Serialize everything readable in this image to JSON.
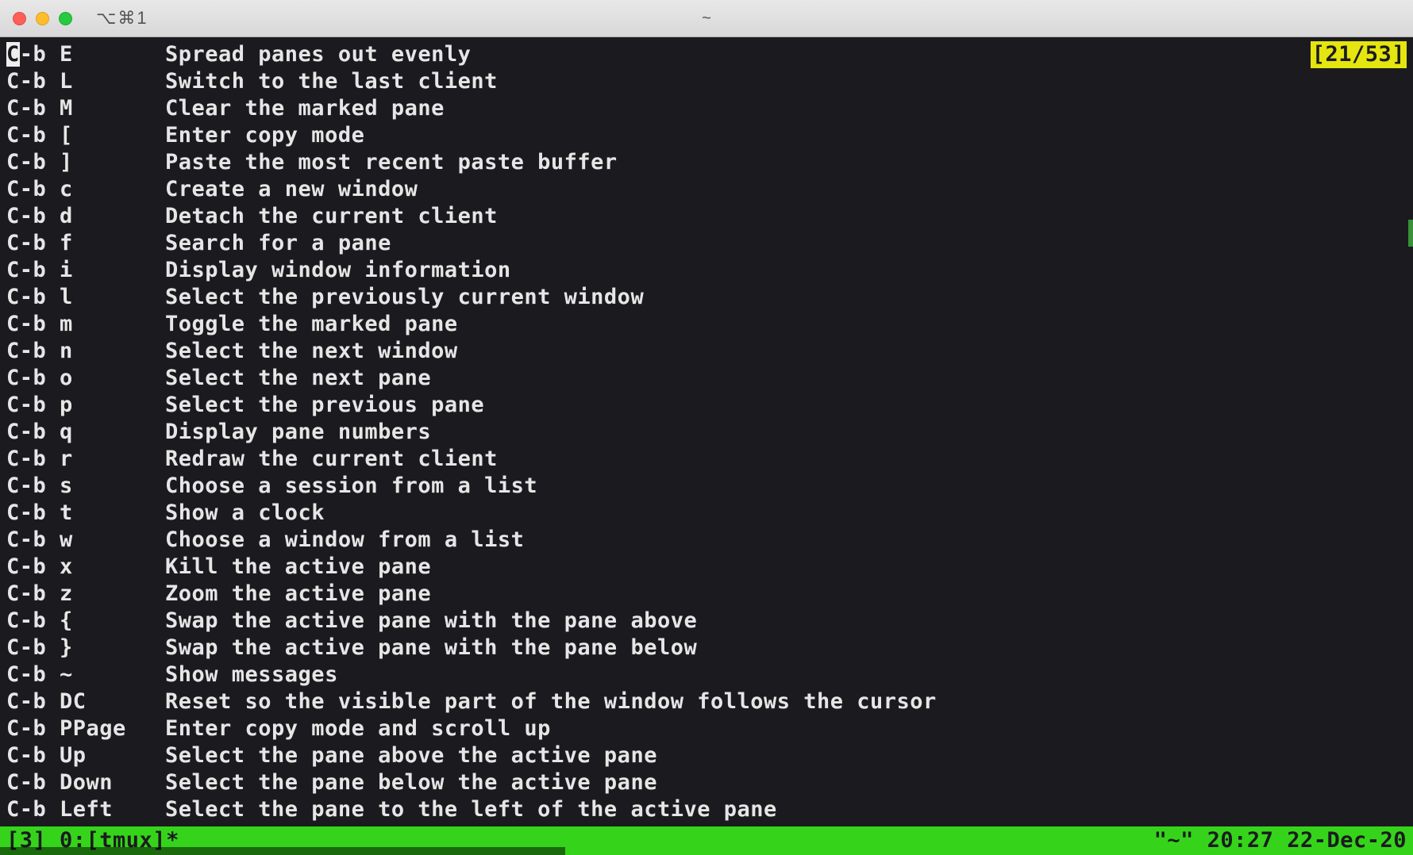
{
  "window": {
    "title_left": "⌥⌘1",
    "title_center": "~"
  },
  "scroll_indicator": "[21/53]",
  "bindings": [
    {
      "key": "C-b E",
      "desc": "Spread panes out evenly"
    },
    {
      "key": "C-b L",
      "desc": "Switch to the last client"
    },
    {
      "key": "C-b M",
      "desc": "Clear the marked pane"
    },
    {
      "key": "C-b [",
      "desc": "Enter copy mode"
    },
    {
      "key": "C-b ]",
      "desc": "Paste the most recent paste buffer"
    },
    {
      "key": "C-b c",
      "desc": "Create a new window"
    },
    {
      "key": "C-b d",
      "desc": "Detach the current client"
    },
    {
      "key": "C-b f",
      "desc": "Search for a pane"
    },
    {
      "key": "C-b i",
      "desc": "Display window information"
    },
    {
      "key": "C-b l",
      "desc": "Select the previously current window"
    },
    {
      "key": "C-b m",
      "desc": "Toggle the marked pane"
    },
    {
      "key": "C-b n",
      "desc": "Select the next window"
    },
    {
      "key": "C-b o",
      "desc": "Select the next pane"
    },
    {
      "key": "C-b p",
      "desc": "Select the previous pane"
    },
    {
      "key": "C-b q",
      "desc": "Display pane numbers"
    },
    {
      "key": "C-b r",
      "desc": "Redraw the current client"
    },
    {
      "key": "C-b s",
      "desc": "Choose a session from a list"
    },
    {
      "key": "C-b t",
      "desc": "Show a clock"
    },
    {
      "key": "C-b w",
      "desc": "Choose a window from a list"
    },
    {
      "key": "C-b x",
      "desc": "Kill the active pane"
    },
    {
      "key": "C-b z",
      "desc": "Zoom the active pane"
    },
    {
      "key": "C-b {",
      "desc": "Swap the active pane with the pane above"
    },
    {
      "key": "C-b }",
      "desc": "Swap the active pane with the pane below"
    },
    {
      "key": "C-b ~",
      "desc": "Show messages"
    },
    {
      "key": "C-b DC",
      "desc": "Reset so the visible part of the window follows the cursor"
    },
    {
      "key": "C-b PPage",
      "desc": "Enter copy mode and scroll up"
    },
    {
      "key": "C-b Up",
      "desc": "Select the pane above the active pane"
    },
    {
      "key": "C-b Down",
      "desc": "Select the pane below the active pane"
    },
    {
      "key": "C-b Left",
      "desc": "Select the pane to the left of the active pane"
    }
  ],
  "statusbar": {
    "left": "[3] 0:[tmux]*",
    "right": "\"~\" 20:27 22-Dec-20"
  }
}
